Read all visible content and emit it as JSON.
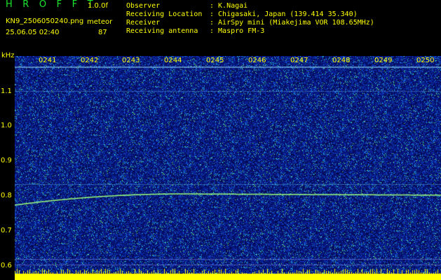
{
  "header": {
    "title": "H R O F F T",
    "version": "1.0.0f",
    "filename": "KN9_2506050240.png",
    "datetime": "25.06.05 02:40",
    "meteor_label": "meteor",
    "meteor_count": "87"
  },
  "info": [
    {
      "label": "Observer",
      "value": ": K.Nagai"
    },
    {
      "label": "Receiving Location",
      "value": ": Chigasaki, Japan (139.414 35.340)"
    },
    {
      "label": "Receiver",
      "value": ": AirSpy mini (Miakejima VOR 108.65MHz)"
    },
    {
      "label": "Receiving antenna",
      "value": ": Maspro FM-3"
    }
  ],
  "axis": {
    "y_unit": "kHz",
    "y_ticks": [
      "1.1",
      "1.0",
      "0.9",
      "0.8",
      "0.7",
      "0.6"
    ],
    "x_ticks": [
      "0241",
      "0242",
      "0243",
      "0244",
      "0245",
      "0246",
      "0247",
      "0248",
      "0249",
      "0250"
    ]
  },
  "colors": {
    "background": "#000000",
    "label_yellow": "#ffff00",
    "label_green": "#19e62d",
    "spectrum_base": "#06106e",
    "signal_trace": "#9dff7a",
    "bottom_band": "#ffff00"
  }
}
